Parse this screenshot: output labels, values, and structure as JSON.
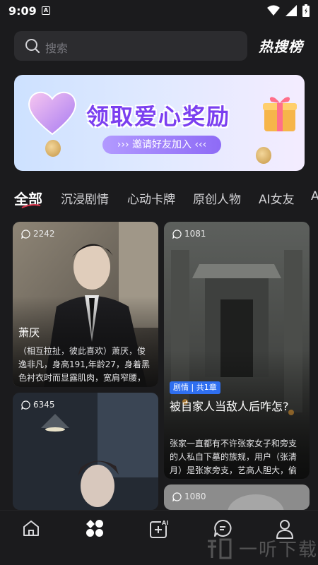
{
  "status_bar": {
    "time": "9:09",
    "notification_icon": "A"
  },
  "search": {
    "placeholder": "搜索",
    "hot_label": "热搜榜"
  },
  "banner": {
    "title": "领取爱心奖励",
    "button_label": "››› 邀请好友加入 ‹‹‹"
  },
  "tabs": [
    {
      "label": "全部",
      "active": true
    },
    {
      "label": "沉浸剧情",
      "active": false
    },
    {
      "label": "心动卡牌",
      "active": false
    },
    {
      "label": "原创人物",
      "active": false
    },
    {
      "label": "AI女友",
      "active": false
    },
    {
      "label": "A",
      "active": false
    }
  ],
  "cards": {
    "c1": {
      "count": "2242",
      "name": "萧厌",
      "desc": "（相互拉扯，彼此喜欢）萧厌，俊逸非凡，身高191,年龄27，身着黑色衬衣时而显露肌肉，宽肩窄腰，身…"
    },
    "c2": {
      "count": "1081",
      "tag": "剧情 | 共1章",
      "title": "被自家人当敌人后咋怎?",
      "desc": "张家一直都有不许张家女子和旁支的人私自下墓的族规，用户（张清月）是张家旁支，艺高人胆大，偷溜下…"
    },
    "c3": {
      "count": "6345"
    },
    "c4": {
      "count": "1080"
    }
  },
  "bottom_nav": [
    "home-icon",
    "discover-icon",
    "ai-create-icon",
    "messages-icon",
    "profile-icon"
  ],
  "watermark": "一听下载",
  "colors": {
    "background": "#1b1b1d",
    "accent": "#7b3ff0",
    "tag": "#2f6ff0"
  }
}
